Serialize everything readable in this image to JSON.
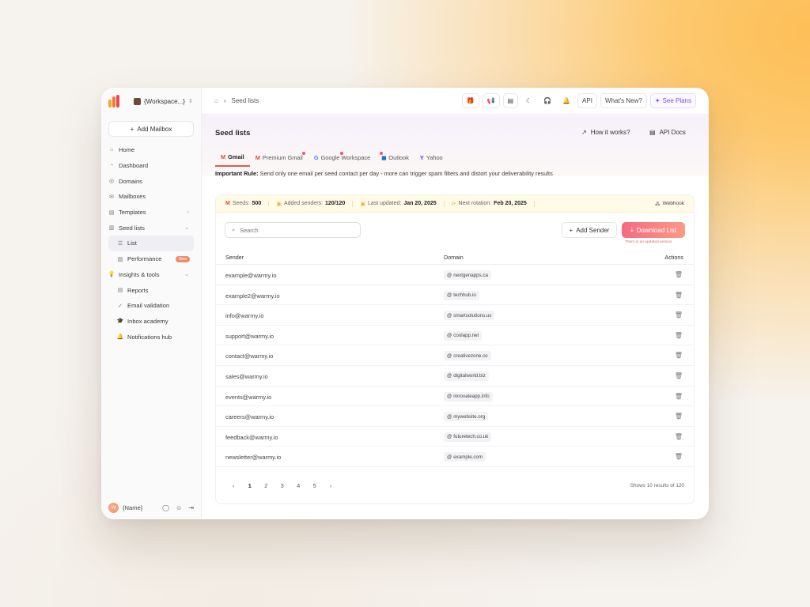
{
  "workspace": {
    "name": "{Workspace...}"
  },
  "sidebar": {
    "add_mailbox": "Add Mailbox",
    "items": [
      {
        "label": "Home",
        "icon": "home-icon"
      },
      {
        "label": "Dashboard",
        "icon": "dashboard-icon"
      },
      {
        "label": "Domains",
        "icon": "globe-icon"
      },
      {
        "label": "Mailboxes",
        "icon": "mail-icon"
      },
      {
        "label": "Templates",
        "icon": "template-icon"
      },
      {
        "label": "Seed lists",
        "icon": "seed-icon"
      },
      {
        "label": "List",
        "icon": "list-icon"
      },
      {
        "label": "Performance",
        "icon": "chart-icon",
        "badge": "New"
      },
      {
        "label": "Insights & tools",
        "icon": "bulb-icon"
      },
      {
        "label": "Reports",
        "icon": "report-icon"
      },
      {
        "label": "Email validation",
        "icon": "check-icon"
      },
      {
        "label": "Inbox  academy",
        "icon": "academy-icon"
      },
      {
        "label": "Notifications hub",
        "icon": "bell-icon"
      }
    ],
    "user": {
      "name": "{Name}"
    }
  },
  "topbar": {
    "breadcrumb": "Seed lists",
    "api": "API",
    "whats_new": "What's New?",
    "see_plans": "See Plans"
  },
  "page": {
    "title": "Seed lists",
    "how_it_works": "How it works?",
    "api_docs": "API Docs",
    "tabs": [
      {
        "label": "Gmail"
      },
      {
        "label": "Premium Gmail"
      },
      {
        "label": "Google Workspace"
      },
      {
        "label": "Outlook"
      },
      {
        "label": "Yahoo"
      }
    ],
    "rule_label": "Important Rule:",
    "rule_text": "Send only one email per seed contact per day - more can trigger spam filters and distort your deliverability results"
  },
  "stats": {
    "seeds_label": "Seeds:",
    "seeds_value": "500",
    "senders_label": "Added senders:",
    "senders_value": "120/120",
    "updated_label": "Last updated:",
    "updated_value": "Jan 20, 2025",
    "rotation_label": "Next rotation:",
    "rotation_value": "Feb 20, 2025",
    "webhook": "Webhook"
  },
  "toolbar": {
    "search_placeholder": "Search",
    "add_sender": "Add Sender",
    "download": "Download List",
    "download_note": "There is an updated version"
  },
  "table": {
    "headers": {
      "sender": "Sender",
      "domain": "Domain",
      "actions": "Actions"
    },
    "rows": [
      {
        "sender": "example@warmy.io",
        "domain": "nextgenapps.ca"
      },
      {
        "sender": "example2@warmy.io",
        "domain": "techhub.io"
      },
      {
        "sender": "info@warmy.io",
        "domain": "smartsolutions.us"
      },
      {
        "sender": "support@warmy.io",
        "domain": "coolapp.net"
      },
      {
        "sender": "contact@warmy.io",
        "domain": "creativezone.co"
      },
      {
        "sender": "sales@warmy.io",
        "domain": "digitalworld.biz"
      },
      {
        "sender": "events@warmy.io",
        "domain": "innovateapp.info"
      },
      {
        "sender": "careers@warmy.io",
        "domain": "mywebsite.org"
      },
      {
        "sender": "feedback@warmy.io",
        "domain": "futuretech.co.uk"
      },
      {
        "sender": "newsletter@warmy.io",
        "domain": "example.com"
      }
    ]
  },
  "pagination": {
    "pages": [
      "1",
      "2",
      "3",
      "4",
      "5"
    ],
    "prev": "‹",
    "next": "›",
    "showing": "Shows 10 results of 120"
  },
  "colors": {
    "accent": "#e05a4b",
    "download": "#f56a7f",
    "see_plans": "#7a4fe3"
  }
}
